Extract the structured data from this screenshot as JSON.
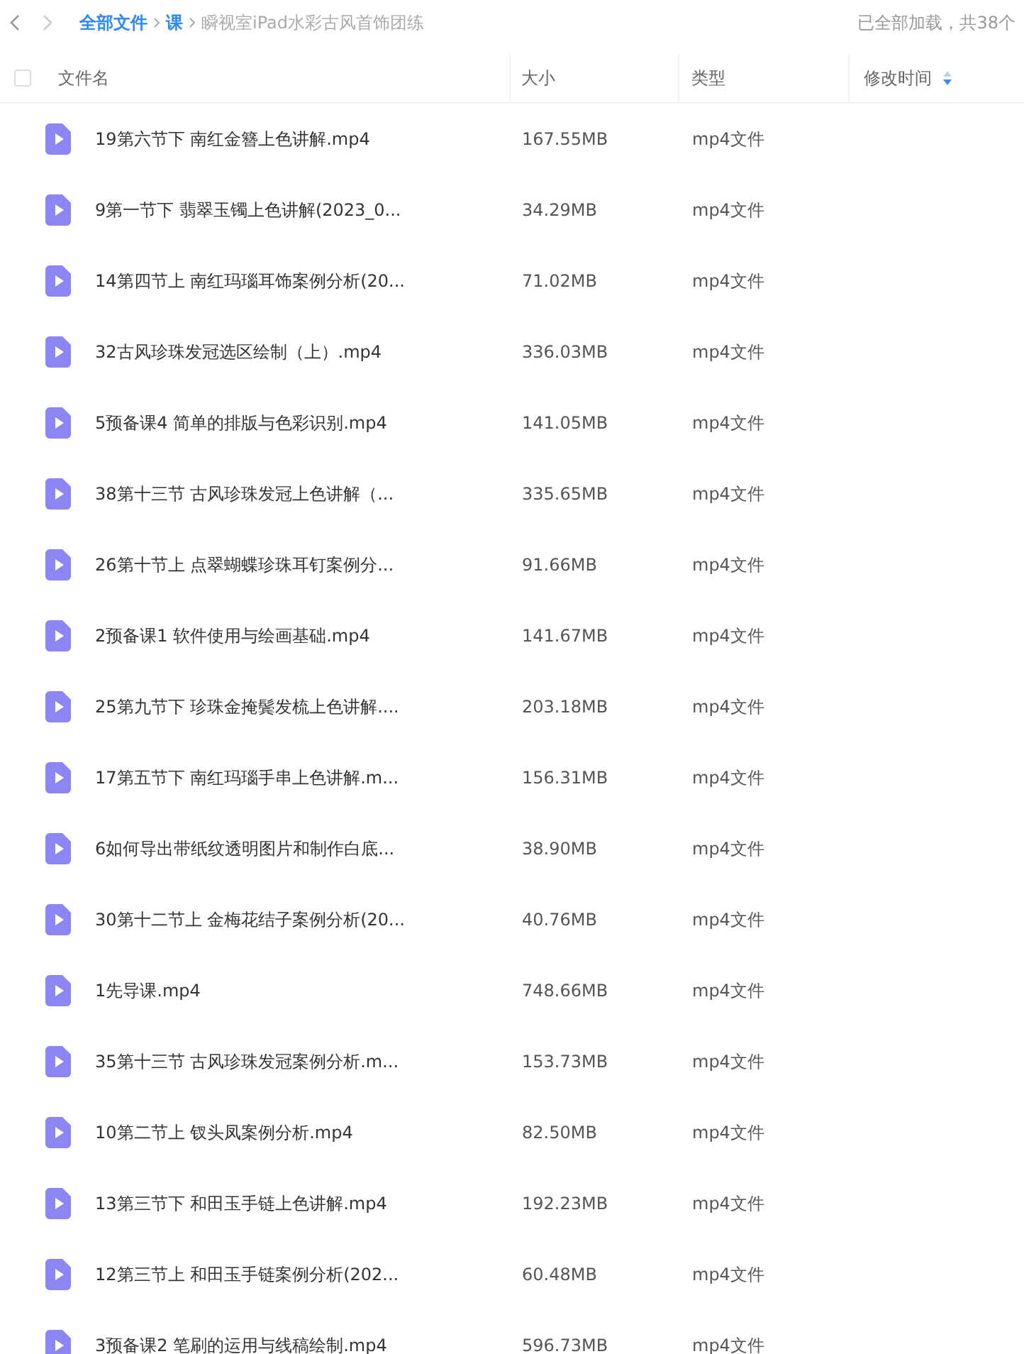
{
  "breadcrumb": [
    {
      "label": "全部文件",
      "kind": "link"
    },
    {
      "label": "课",
      "kind": "link"
    },
    {
      "label": "瞬视室iPad水彩古风首饰团练",
      "kind": "current"
    }
  ],
  "status": "已全部加载，共38个",
  "header": {
    "checked": false,
    "columns": [
      {
        "label": "文件名",
        "sorted": false
      },
      {
        "label": "大小",
        "sorted": false
      },
      {
        "label": "类型",
        "sorted": false
      },
      {
        "label": "修改时间",
        "sorted": true
      }
    ]
  },
  "rows": [
    {
      "name": "19第六节下 南红金簪上色讲解.mp4",
      "size": "167.55MB",
      "type": "mp4文件"
    },
    {
      "name": "9第一节下 翡翠玉镯上色讲解(2023_0...",
      "size": "34.29MB",
      "type": "mp4文件"
    },
    {
      "name": "14第四节上 南红玛瑙耳饰案例分析(20...",
      "size": "71.02MB",
      "type": "mp4文件"
    },
    {
      "name": "32古风珍珠发冠选区绘制（上）.mp4",
      "size": "336.03MB",
      "type": "mp4文件"
    },
    {
      "name": "5预备课4 简单的排版与色彩识别.mp4",
      "size": "141.05MB",
      "type": "mp4文件"
    },
    {
      "name": "38第十三节 古风珍珠发冠上色讲解（...",
      "size": "335.65MB",
      "type": "mp4文件"
    },
    {
      "name": "26第十节上 点翠蝴蝶珍珠耳钉案例分...",
      "size": "91.66MB",
      "type": "mp4文件"
    },
    {
      "name": "2预备课1 软件使用与绘画基础.mp4",
      "size": "141.67MB",
      "type": "mp4文件"
    },
    {
      "name": "25第九节下 珍珠金掩鬓发梳上色讲解....",
      "size": "203.18MB",
      "type": "mp4文件"
    },
    {
      "name": "17第五节下 南红玛瑙手串上色讲解.m...",
      "size": "156.31MB",
      "type": "mp4文件"
    },
    {
      "name": "6如何导出带纸纹透明图片和制作白底...",
      "size": "38.90MB",
      "type": "mp4文件"
    },
    {
      "name": "30第十二节上 金梅花结子案例分析(20...",
      "size": "40.76MB",
      "type": "mp4文件"
    },
    {
      "name": "1先导课.mp4",
      "size": "748.66MB",
      "type": "mp4文件"
    },
    {
      "name": "35第十三节 古风珍珠发冠案例分析.m...",
      "size": "153.73MB",
      "type": "mp4文件"
    },
    {
      "name": "10第二节上 钗头凤案例分析.mp4",
      "size": "82.50MB",
      "type": "mp4文件"
    },
    {
      "name": "13第三节下 和田玉手链上色讲解.mp4",
      "size": "192.23MB",
      "type": "mp4文件"
    },
    {
      "name": "12第三节上 和田玉手链案例分析(202...",
      "size": "60.48MB",
      "type": "mp4文件"
    },
    {
      "name": "3预备课2 笔刷的运用与线稿绘制.mp4",
      "size": "596.73MB",
      "type": "mp4文件"
    }
  ]
}
